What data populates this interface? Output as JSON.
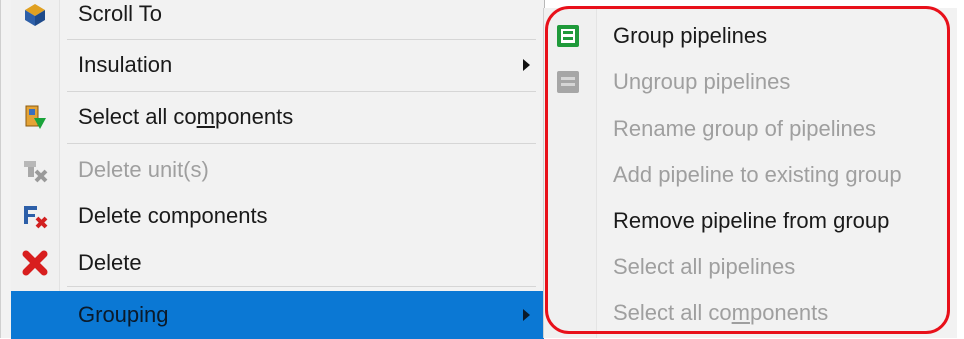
{
  "main_menu": {
    "items": [
      {
        "label": "Scroll To",
        "icon": "scroll-to-icon",
        "disabled": false
      },
      {
        "label": "Insulation",
        "icon": "",
        "disabled": false,
        "submenu": true
      },
      {
        "label_pre": "Select all co",
        "label_ul": "m",
        "label_post": "ponents",
        "icon": "select-components-icon",
        "disabled": false
      },
      {
        "label": "Delete unit(s)",
        "icon": "delete-unit-icon",
        "disabled": true
      },
      {
        "label": "Delete components",
        "icon": "delete-components-icon",
        "disabled": false
      },
      {
        "label": "Delete",
        "icon": "delete-x-icon",
        "disabled": false
      },
      {
        "label": "Grouping",
        "icon": "",
        "disabled": false,
        "submenu": true,
        "highlighted": true
      }
    ]
  },
  "sub_menu": {
    "items": [
      {
        "label": "Group pipelines",
        "icon": "group-pipelines-icon",
        "disabled": false
      },
      {
        "label": "Ungroup pipelines",
        "icon": "ungroup-pipelines-icon",
        "disabled": true
      },
      {
        "label": "Rename group of pipelines",
        "disabled": true
      },
      {
        "label": "Add pipeline to existing group",
        "disabled": true
      },
      {
        "label": "Remove pipeline from group",
        "disabled": false
      },
      {
        "label": "Select all pipelines",
        "disabled": true
      },
      {
        "label_pre": "Select all co",
        "label_ul": "m",
        "label_post": "ponents",
        "disabled": true
      }
    ]
  },
  "colors": {
    "highlight": "#0b78d4",
    "annotation_outline": "#e8101a",
    "disabled_text": "#9f9f9f"
  }
}
